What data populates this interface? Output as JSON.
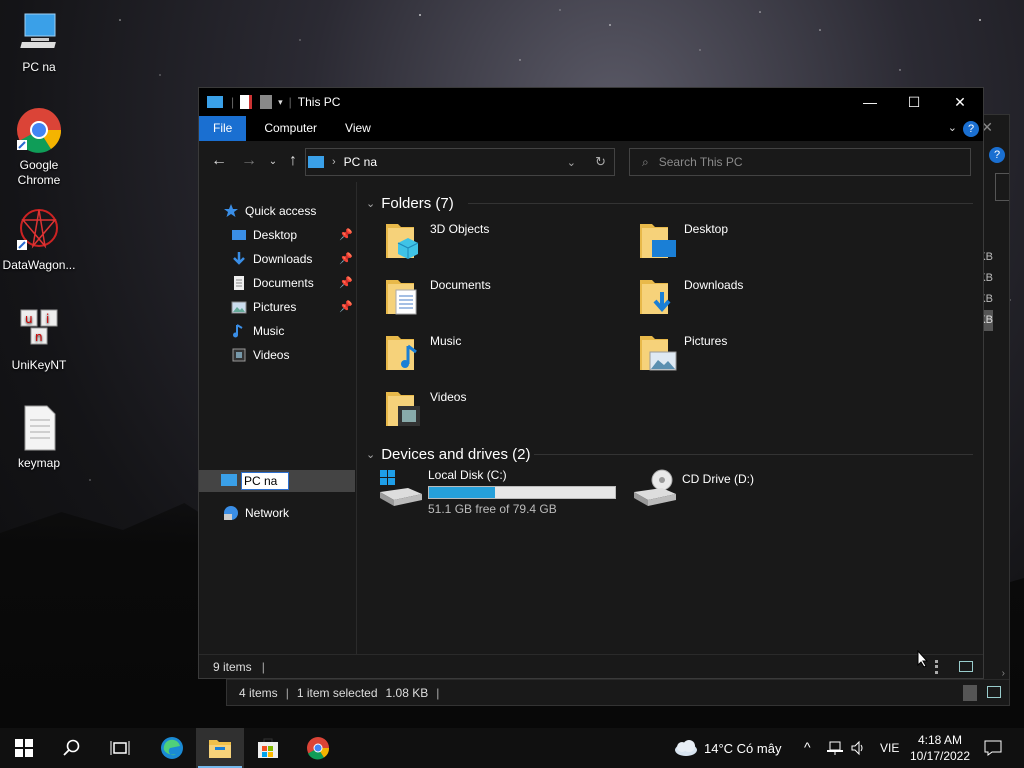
{
  "desktop": {
    "icons": [
      {
        "label": "PC na"
      },
      {
        "label": "Google Chrome"
      },
      {
        "label": "DataWagon..."
      },
      {
        "label": "UniKeyNT"
      },
      {
        "label": "keymap"
      }
    ]
  },
  "background_window": {
    "status": {
      "items": "4 items",
      "selected": "1 item selected",
      "size": "1.08 KB"
    },
    "right_column": [
      "KB",
      "KB",
      "KB",
      "KB"
    ]
  },
  "window": {
    "title": "This PC",
    "controls": {
      "minimize": "—",
      "maximize": "☐",
      "close": "✕"
    },
    "ribbon_tabs": [
      "File",
      "Computer",
      "View"
    ],
    "address": {
      "location": "PC na"
    },
    "search": {
      "placeholder": "Search This PC"
    },
    "nav_pane": {
      "quick_access": "Quick access",
      "items": [
        {
          "label": "Desktop",
          "pinned": true
        },
        {
          "label": "Downloads",
          "pinned": true
        },
        {
          "label": "Documents",
          "pinned": true
        },
        {
          "label": "Pictures",
          "pinned": true
        },
        {
          "label": "Music",
          "pinned": false
        },
        {
          "label": "Videos",
          "pinned": false
        }
      ],
      "rename_value": "PC na",
      "network": "Network"
    },
    "folders_header": "Folders (7)",
    "folders": [
      {
        "name": "3D Objects",
        "icon": "3d-objects-icon"
      },
      {
        "name": "Desktop",
        "icon": "desktop-folder-icon"
      },
      {
        "name": "Documents",
        "icon": "documents-folder-icon"
      },
      {
        "name": "Downloads",
        "icon": "downloads-folder-icon"
      },
      {
        "name": "Music",
        "icon": "music-folder-icon"
      },
      {
        "name": "Pictures",
        "icon": "pictures-folder-icon"
      },
      {
        "name": "Videos",
        "icon": "videos-folder-icon"
      }
    ],
    "drives_header": "Devices and drives (2)",
    "drives": [
      {
        "name": "Local Disk (C:)",
        "free": "51.1 GB free of 79.4 GB",
        "used_fraction": 0.356
      },
      {
        "name": "CD Drive (D:)"
      }
    ],
    "status": {
      "items": "9 items"
    }
  },
  "taskbar": {
    "weather": "14°C  Có mây",
    "language": "VIE",
    "time": "4:18 AM",
    "date": "10/17/2022"
  },
  "colors": {
    "accent": "#1a6fd1",
    "progress": "#26a0da",
    "folder": "#f0c04a"
  }
}
